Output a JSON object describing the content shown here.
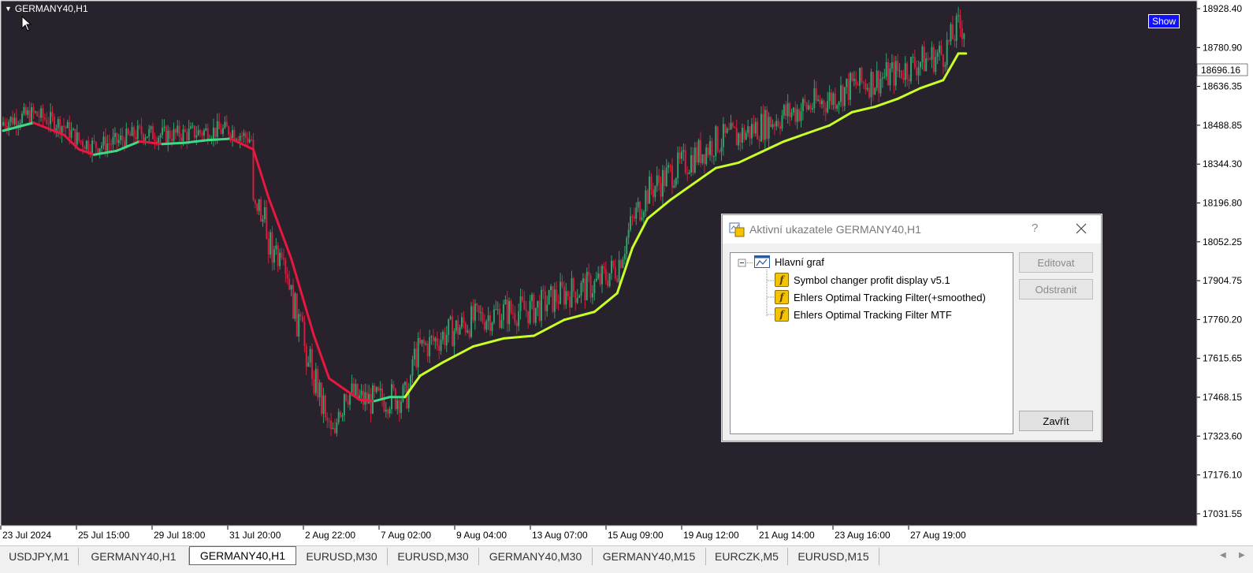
{
  "chart": {
    "symbol_label": "GERMANY40,H1",
    "show_button": "Show",
    "current_price": "18696.16",
    "colors": {
      "background": "#27222b",
      "bullish_candle": "#2fa36b",
      "bearish_candle": "#d11f3f",
      "filter_up": "#3ddc84",
      "filter_down": "#e8173f",
      "filter_mtf": "#c8ff28",
      "price_label_bg": "#ffffff"
    },
    "price_ticks": [
      "18928.40",
      "18780.90",
      "18636.35",
      "18488.85",
      "18344.30",
      "18196.80",
      "18052.25",
      "17904.75",
      "17760.20",
      "17615.65",
      "17468.15",
      "17323.60",
      "17176.10",
      "17031.55"
    ],
    "time_ticks": [
      "23 Jul 2024",
      "25 Jul 15:00",
      "29 Jul 18:00",
      "31 Jul 20:00",
      "2 Aug 22:00",
      "7 Aug 02:00",
      "9 Aug 04:00",
      "13 Aug 07:00",
      "15 Aug 09:00",
      "19 Aug 12:00",
      "21 Aug 14:00",
      "23 Aug 16:00",
      "27 Aug 19:00"
    ]
  },
  "chart_data": {
    "type": "line",
    "title": "GERMANY40,H1",
    "ylim": [
      17000,
      18960
    ],
    "series": [
      {
        "name": "Ehlers Optimal Tracking Filter",
        "points": [
          {
            "t": 0,
            "v": 18470
          },
          {
            "t": 4,
            "v": 18500
          },
          {
            "t": 8,
            "v": 18455
          },
          {
            "t": 10,
            "v": 18400
          },
          {
            "t": 12,
            "v": 18380
          },
          {
            "t": 15,
            "v": 18395
          },
          {
            "t": 18,
            "v": 18430
          },
          {
            "t": 21,
            "v": 18420
          },
          {
            "t": 24,
            "v": 18425
          },
          {
            "t": 27,
            "v": 18435
          },
          {
            "t": 30,
            "v": 18440
          },
          {
            "t": 33,
            "v": 18400
          },
          {
            "t": 35,
            "v": 18220
          },
          {
            "t": 38,
            "v": 17990
          },
          {
            "t": 41,
            "v": 17700
          },
          {
            "t": 43,
            "v": 17540
          },
          {
            "t": 45,
            "v": 17500
          },
          {
            "t": 47,
            "v": 17460
          },
          {
            "t": 49,
            "v": 17455
          },
          {
            "t": 51,
            "v": 17470
          },
          {
            "t": 53,
            "v": 17470
          },
          {
            "t": 55,
            "v": 17550
          },
          {
            "t": 58,
            "v": 17600
          },
          {
            "t": 62,
            "v": 17660
          },
          {
            "t": 66,
            "v": 17690
          },
          {
            "t": 70,
            "v": 17700
          },
          {
            "t": 74,
            "v": 17760
          },
          {
            "t": 78,
            "v": 17790
          },
          {
            "t": 81,
            "v": 17860
          },
          {
            "t": 83,
            "v": 18030
          },
          {
            "t": 85,
            "v": 18140
          },
          {
            "t": 88,
            "v": 18210
          },
          {
            "t": 91,
            "v": 18270
          },
          {
            "t": 94,
            "v": 18330
          },
          {
            "t": 97,
            "v": 18350
          },
          {
            "t": 100,
            "v": 18390
          },
          {
            "t": 103,
            "v": 18430
          },
          {
            "t": 106,
            "v": 18460
          },
          {
            "t": 109,
            "v": 18490
          },
          {
            "t": 112,
            "v": 18540
          },
          {
            "t": 115,
            "v": 18560
          },
          {
            "t": 118,
            "v": 18590
          },
          {
            "t": 121,
            "v": 18630
          },
          {
            "t": 124,
            "v": 18660
          },
          {
            "t": 126,
            "v": 18760
          },
          {
            "t": 127,
            "v": 18760
          }
        ]
      }
    ]
  },
  "dialog": {
    "title": "Aktivní ukazatele GERMANY40,H1",
    "help": "?",
    "tree_root": "Hlavní graf",
    "indicators": [
      "Symbol changer profit display v5.1",
      "Ehlers Optimal Tracking Filter(+smoothed)",
      "Ehlers Optimal Tracking Filter MTF"
    ],
    "buttons": {
      "edit": "Editovat",
      "remove": "Odstranit",
      "close": "Zavřít"
    }
  },
  "tabs": [
    {
      "label": "USDJPY,M1",
      "active": false
    },
    {
      "label": "GERMANY40,H1",
      "active": false
    },
    {
      "label": "GERMANY40,H1",
      "active": true
    },
    {
      "label": "EURUSD,M30",
      "active": false
    },
    {
      "label": "EURUSD,M30",
      "active": false
    },
    {
      "label": "GERMANY40,M30",
      "active": false
    },
    {
      "label": "GERMANY40,M15",
      "active": false
    },
    {
      "label": "EURCZK,M5",
      "active": false
    },
    {
      "label": "EURUSD,M15",
      "active": false
    }
  ],
  "icons": {
    "dropdown": "triangle-down-icon",
    "cursor": "mouse-pointer-icon",
    "tree_collapse": "minus-box-icon",
    "chart": "chart-window-icon",
    "indicator": "custom-indicator-icon",
    "dialog": "indicators-list-icon",
    "close": "close-icon",
    "scroll_left": "arrow-left-icon",
    "scroll_right": "arrow-right-icon"
  }
}
